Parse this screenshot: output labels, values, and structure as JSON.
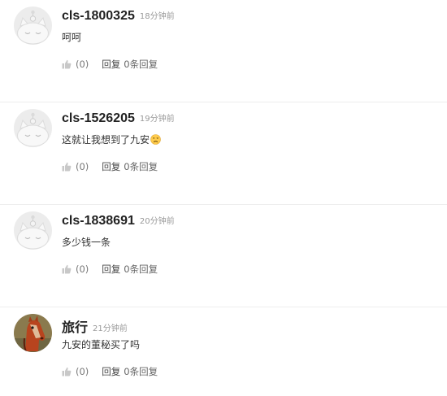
{
  "comments": [
    {
      "username": "cls-1800325",
      "time": "18分钟前",
      "text": "呵呵",
      "emoji": "",
      "likes": "(0)",
      "reply_label": "回复",
      "reply_count": "0条回复",
      "avatar": "default-cat-avatar-icon"
    },
    {
      "username": "cls-1526205",
      "time": "19分钟前",
      "text": "这就让我想到了九安",
      "emoji": "sad-face-icon",
      "likes": "(0)",
      "reply_label": "回复",
      "reply_count": "0条回复",
      "avatar": "default-cat-avatar-icon"
    },
    {
      "username": "cls-1838691",
      "time": "20分钟前",
      "text": "多少钱一条",
      "emoji": "",
      "likes": "(0)",
      "reply_label": "回复",
      "reply_count": "0条回复",
      "avatar": "default-cat-avatar-icon"
    },
    {
      "username": "旅行",
      "time": "21分钟前",
      "text": "九安的董秘买了吗",
      "emoji": "",
      "likes": "(0)",
      "reply_label": "回复",
      "reply_count": "0条回复",
      "avatar": "horse-head-avatar-icon"
    }
  ],
  "colors": {
    "username": "#222222",
    "timestamp": "#999999",
    "action_text": "#666666",
    "divider": "#eeeeee",
    "avatar_bg": "#ececec"
  }
}
